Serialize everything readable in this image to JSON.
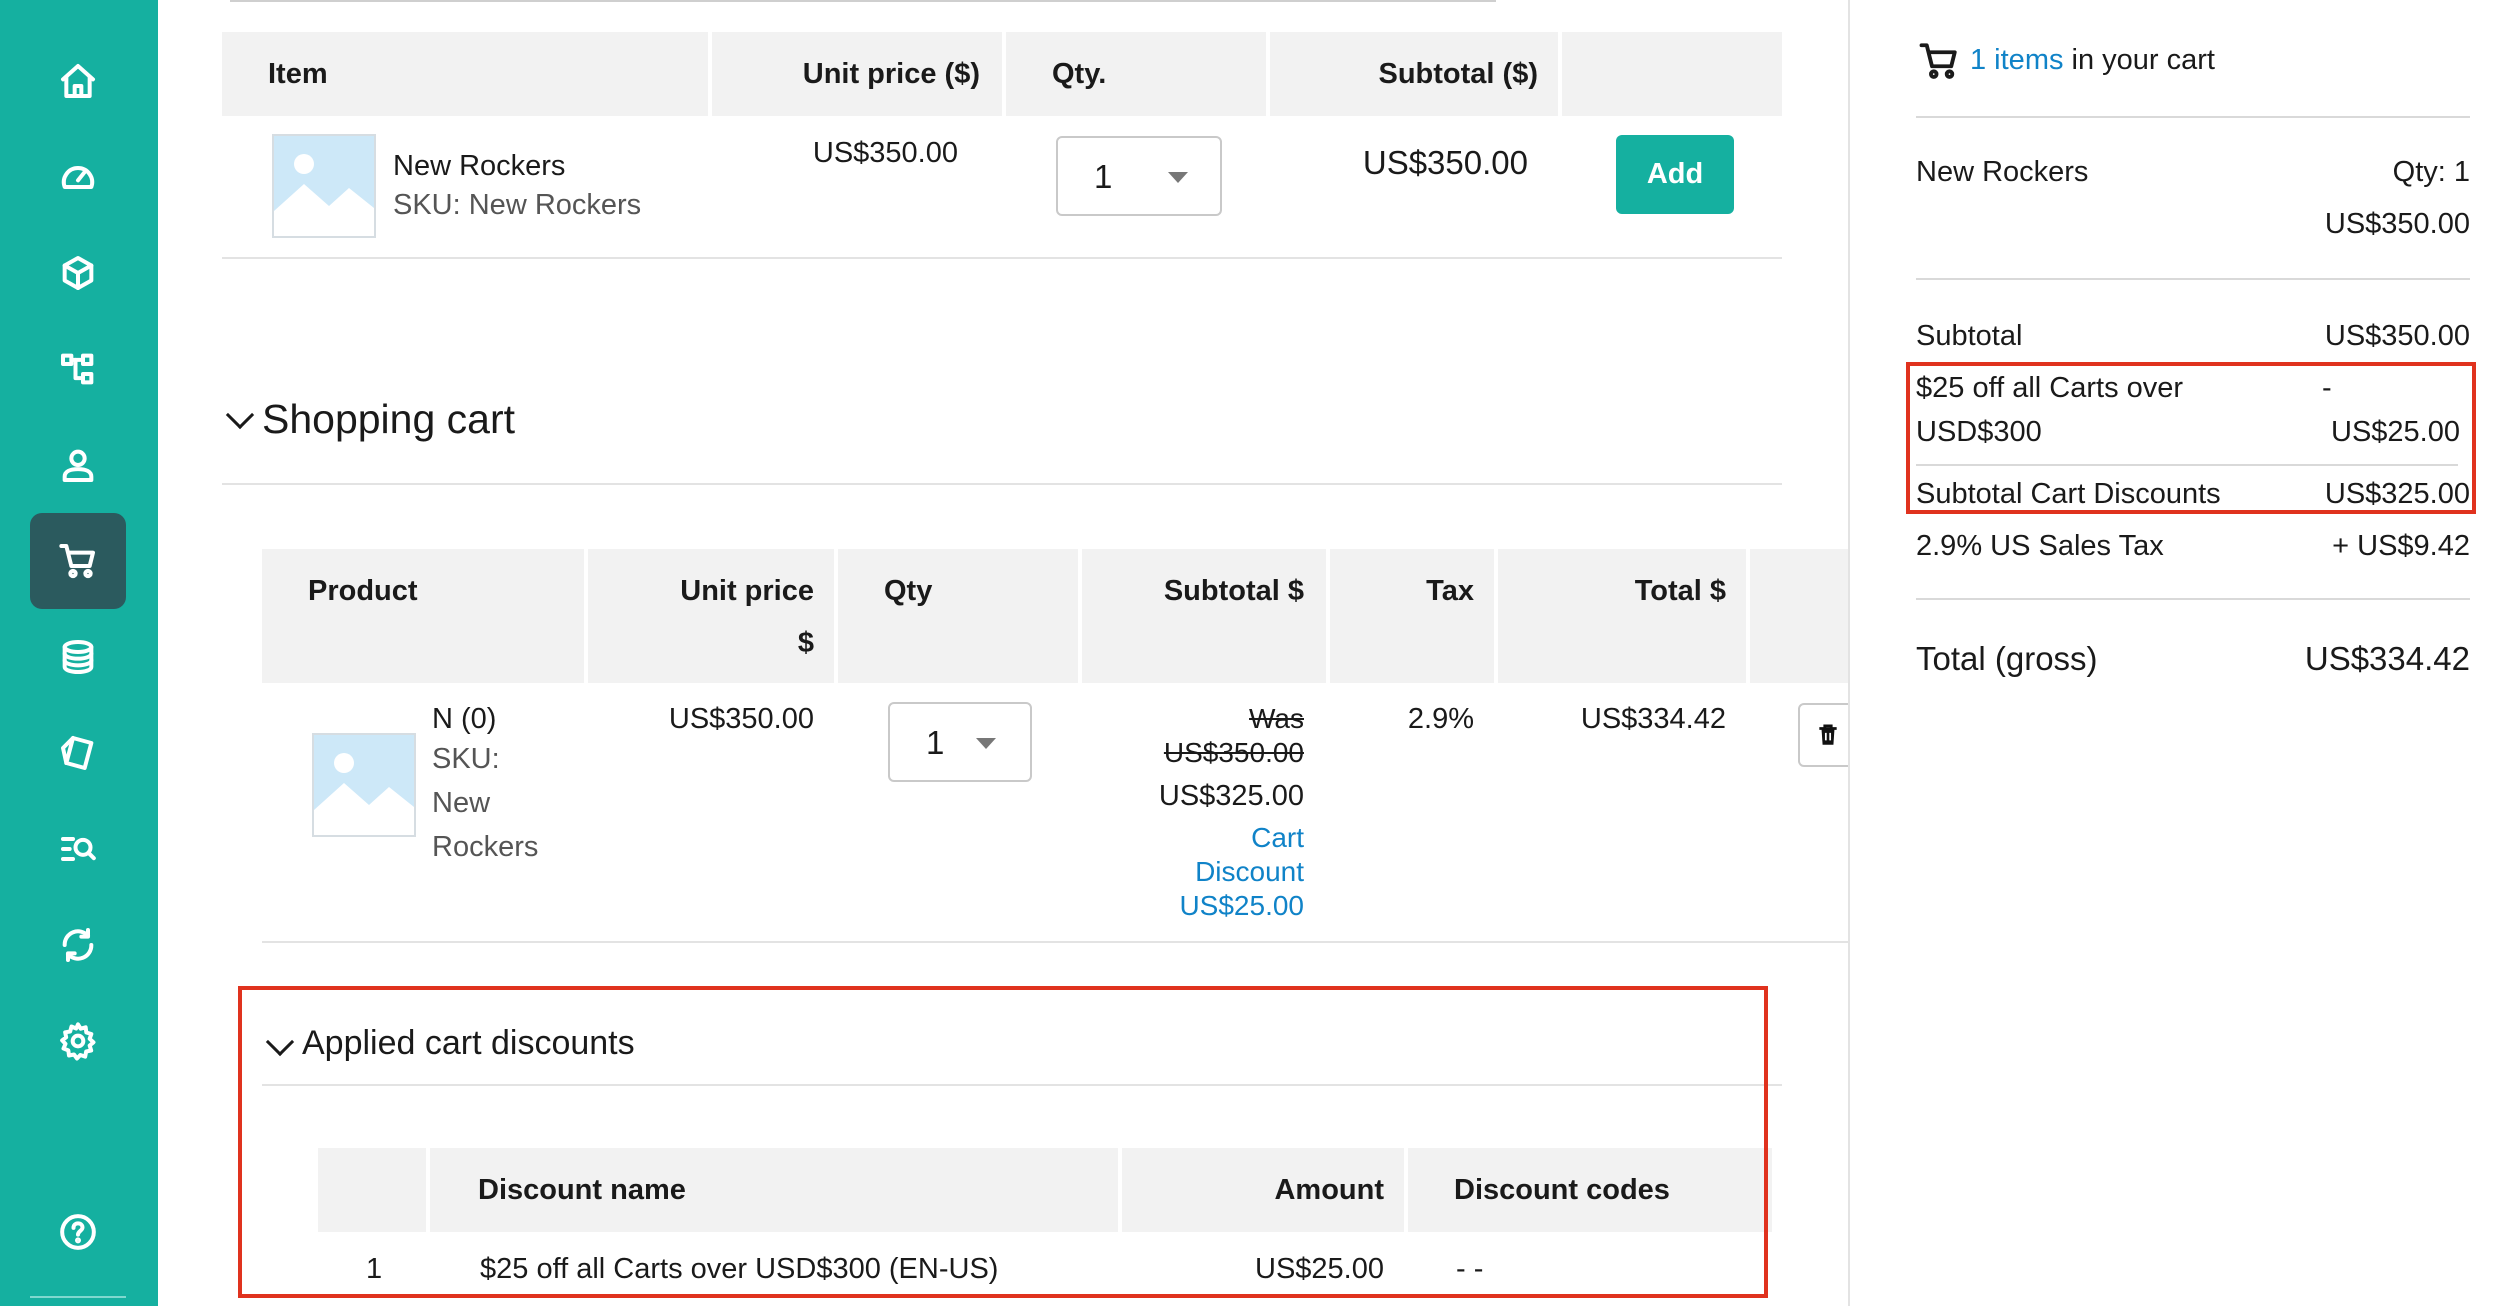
{
  "sidebar": {
    "items": [
      {
        "name": "home-icon"
      },
      {
        "name": "dashboard-icon"
      },
      {
        "name": "products-icon"
      },
      {
        "name": "categories-icon"
      },
      {
        "name": "customers-icon"
      },
      {
        "name": "cart-icon",
        "active": true
      },
      {
        "name": "orders-icon"
      },
      {
        "name": "discounts-icon"
      },
      {
        "name": "search-icon"
      },
      {
        "name": "operations-icon"
      },
      {
        "name": "settings-icon"
      },
      {
        "name": "help-icon"
      }
    ],
    "accent": "#15b0a0",
    "active_bg": "#2b5a5e"
  },
  "add_products_table": {
    "headers": {
      "item": "Item",
      "unit_price": "Unit price ($)",
      "qty": "Qty.",
      "subtotal": "Subtotal ($)"
    },
    "row": {
      "name": "New Rockers",
      "sku": "SKU: New Rockers",
      "unit_price": "US$350.00",
      "qty": "1",
      "subtotal": "US$350.00",
      "add_label": "Add"
    }
  },
  "shopping_cart": {
    "title": "Shopping cart",
    "headers": {
      "product": "Product",
      "unit_price_1": "Unit price",
      "unit_price_2": "$",
      "qty": "Qty",
      "subtotal": "Subtotal $",
      "tax": "Tax",
      "total": "Total $"
    },
    "row": {
      "name": "N (0)",
      "sku_lines": [
        "SKU:",
        "New",
        "Rockers"
      ],
      "unit_price": "US$350.00",
      "qty": "1",
      "was_label": "Was",
      "was_value": "US$350.00",
      "subtotal": "US$325.00",
      "discount_lines": [
        "Cart",
        "Discount",
        "US$25.00"
      ],
      "tax": "2.9%",
      "total": "US$334.42"
    }
  },
  "applied_discounts": {
    "title": "Applied cart discounts",
    "headers": {
      "name": "Discount name",
      "amount": "Amount",
      "codes": "Discount codes"
    },
    "rows": [
      {
        "index": "1",
        "name": "$25 off all Carts over USD$300 (EN-US)",
        "amount": "US$25.00",
        "codes": "- -"
      }
    ]
  },
  "cart_summary": {
    "items_link": "1 items",
    "items_suffix": "in your cart",
    "item_name": "New Rockers",
    "item_qty": "Qty: 1",
    "item_price": "US$350.00",
    "subtotal_label": "Subtotal",
    "subtotal_value": "US$350.00",
    "discount_label_1": "$25 off all Carts over",
    "discount_label_2": "USD$300",
    "discount_dash": "-",
    "discount_value": "US$25.00",
    "subtotal_discounts_label": "Subtotal Cart Discounts",
    "subtotal_discounts_value": "US$325.00",
    "tax_label": "2.9% US Sales Tax",
    "tax_value": "+ US$9.42",
    "total_label": "Total (gross)",
    "total_value": "US$334.42"
  },
  "colors": {
    "link": "#1083c8",
    "highlight": "#e0321e"
  }
}
